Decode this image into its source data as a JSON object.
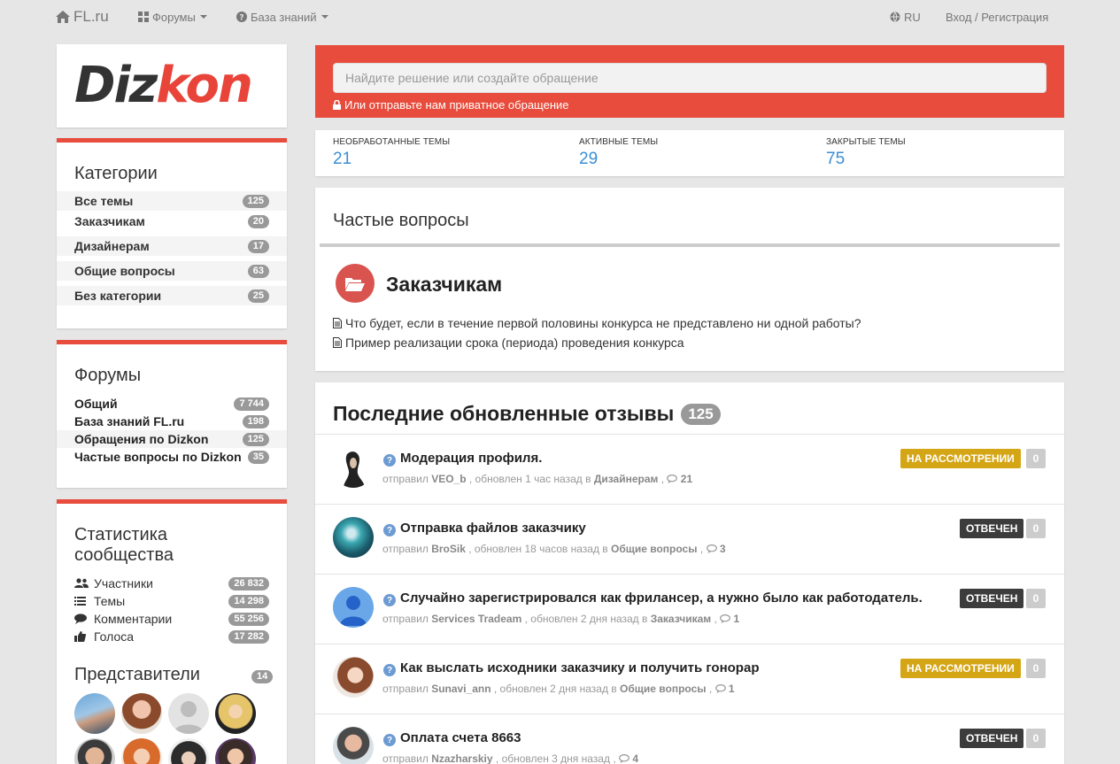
{
  "nav": {
    "brand": "FL.ru",
    "forums": "Форумы",
    "knowledge": "База знаний",
    "lang": "RU",
    "login": "Вход / Регистрация"
  },
  "logo": {
    "part1": "Diz",
    "part2": "kon"
  },
  "categories": {
    "title": "Категории",
    "items": [
      {
        "label": "Все темы",
        "count": "125"
      },
      {
        "label": "Заказчикам",
        "count": "20"
      },
      {
        "label": "Дизайнерам",
        "count": "17"
      },
      {
        "label": "Общие вопросы",
        "count": "63"
      },
      {
        "label": "Без категории",
        "count": "25"
      }
    ]
  },
  "forums": {
    "title": "Форумы",
    "items": [
      {
        "label": "Общий",
        "count": "7 744"
      },
      {
        "label": "База знаний FL.ru",
        "count": "198"
      },
      {
        "label": "Обращения по Dizkon",
        "count": "125"
      },
      {
        "label": "Частые вопросы по Dizkon",
        "count": "35"
      }
    ]
  },
  "community": {
    "title_line1": "Статистика",
    "title_line2": "сообщества",
    "items": [
      {
        "label": "Участники",
        "count": "26 832",
        "icon": "users-icon"
      },
      {
        "label": "Темы",
        "count": "14 298",
        "icon": "list-icon"
      },
      {
        "label": "Комментарии",
        "count": "55 256",
        "icon": "comments-icon"
      },
      {
        "label": "Голоса",
        "count": "17 282",
        "icon": "thumbs-up-icon"
      }
    ]
  },
  "reps": {
    "title": "Представители",
    "count": "14"
  },
  "search": {
    "placeholder": "Найдите решение или создайте обращение",
    "private_link": "Или отправьте нам приватное обращение"
  },
  "topic_stats": [
    {
      "label": "НЕОБРАБОТАННЫЕ ТЕМЫ",
      "value": "21"
    },
    {
      "label": "АКТИВНЫЕ ТЕМЫ",
      "value": "29"
    },
    {
      "label": "ЗАКРЫТЫЕ ТЕМЫ",
      "value": "75"
    }
  ],
  "faq": {
    "title": "Частые вопросы",
    "category": "Заказчикам",
    "questions": [
      "Что будет, если в течение первой половины конкурса не представлено ни одной работы?",
      "Пример реализации срока (периода) проведения конкурса"
    ]
  },
  "reviews": {
    "title": "Последние обновленные отзывы",
    "count": "125",
    "sent_by": "отправил",
    "items": [
      {
        "title": "Модерация профиля.",
        "author": "VEO_b",
        "updated": ", обновлен 1 час назад в",
        "category": "Дизайнерам",
        "comments": "21",
        "status": "НА РАССМОТРЕНИИ",
        "status_color": "#d4a514",
        "votes": "0"
      },
      {
        "title": "Отправка файлов заказчику",
        "author": "BroSik",
        "updated": ", обновлен 18 часов назад в",
        "category": "Общие вопросы",
        "comments": "3",
        "status": "ОТВЕЧЕН",
        "status_color": "#3c3c3c",
        "votes": "0"
      },
      {
        "title": "Случайно зарегистрировался как фрилансер, а нужно было как работодатель.",
        "author": "Services Tradeam",
        "updated": ", обновлен 2 дня назад в",
        "category": "Заказчикам",
        "comments": "1",
        "status": "ОТВЕЧЕН",
        "status_color": "#3c3c3c",
        "votes": "0"
      },
      {
        "title": "Как выслать исходники заказчику и получить гонорар",
        "author": "Sunavi_ann",
        "updated": ", обновлен 2 дня назад в",
        "category": "Общие вопросы",
        "comments": "1",
        "status": "НА РАССМОТРЕНИИ",
        "status_color": "#d4a514",
        "votes": "0"
      },
      {
        "title": "Оплата счета 8663",
        "author": "Nzazharskiy",
        "updated": ", обновлен 3 дня назад",
        "category": "",
        "comments": "4",
        "status": "ОТВЕЧЕН",
        "status_color": "#3c3c3c",
        "votes": "0"
      }
    ]
  }
}
